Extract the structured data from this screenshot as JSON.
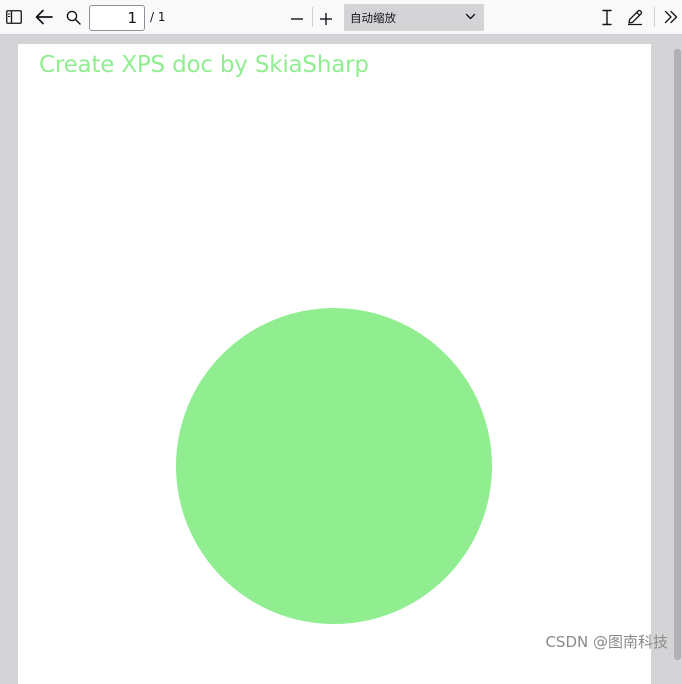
{
  "toolbar": {
    "page_number": "1",
    "page_count": "/ 1",
    "zoom_value": "自动缩放",
    "icons": {
      "sidebar": "sidebar-toggle-icon",
      "back": "back-arrow-icon",
      "search": "search-icon",
      "zoom_out": "minus-icon",
      "zoom_in": "plus-icon",
      "text_tool": "text-cursor-icon",
      "draw_tool": "pen-icon",
      "more": "double-chevron-right-icon"
    }
  },
  "document": {
    "title": "Create XPS doc by SkiaSharp",
    "title_color": "#90ee90",
    "circle_color": "#90ee90"
  },
  "watermark": "CSDN @图南科技"
}
